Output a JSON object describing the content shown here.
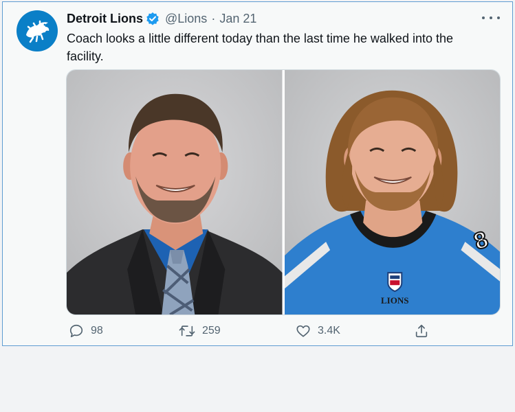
{
  "tweet": {
    "author_name": "Detroit Lions",
    "handle": "@Lions",
    "separator": "·",
    "date": "Jan 21",
    "text": "Coach looks a little different today than the last time he walked into the facility.",
    "media": [
      {
        "alt": "man in suit with blue shirt and plaid tie"
      },
      {
        "alt": "man with long hair wearing Lions jersey"
      }
    ],
    "jersey_text": "LIONS",
    "actions": {
      "reply_count": "98",
      "retweet_count": "259",
      "like_count": "3.4K"
    },
    "icons": {
      "avatar": "lion-logo-icon",
      "verified": "verified-badge-icon",
      "more": "more-icon",
      "reply": "reply-icon",
      "retweet": "retweet-icon",
      "like": "heart-icon",
      "share": "share-icon"
    },
    "colors": {
      "brand": "#0a7fc7",
      "verified": "#1d9bf0",
      "muted": "#536471"
    }
  }
}
